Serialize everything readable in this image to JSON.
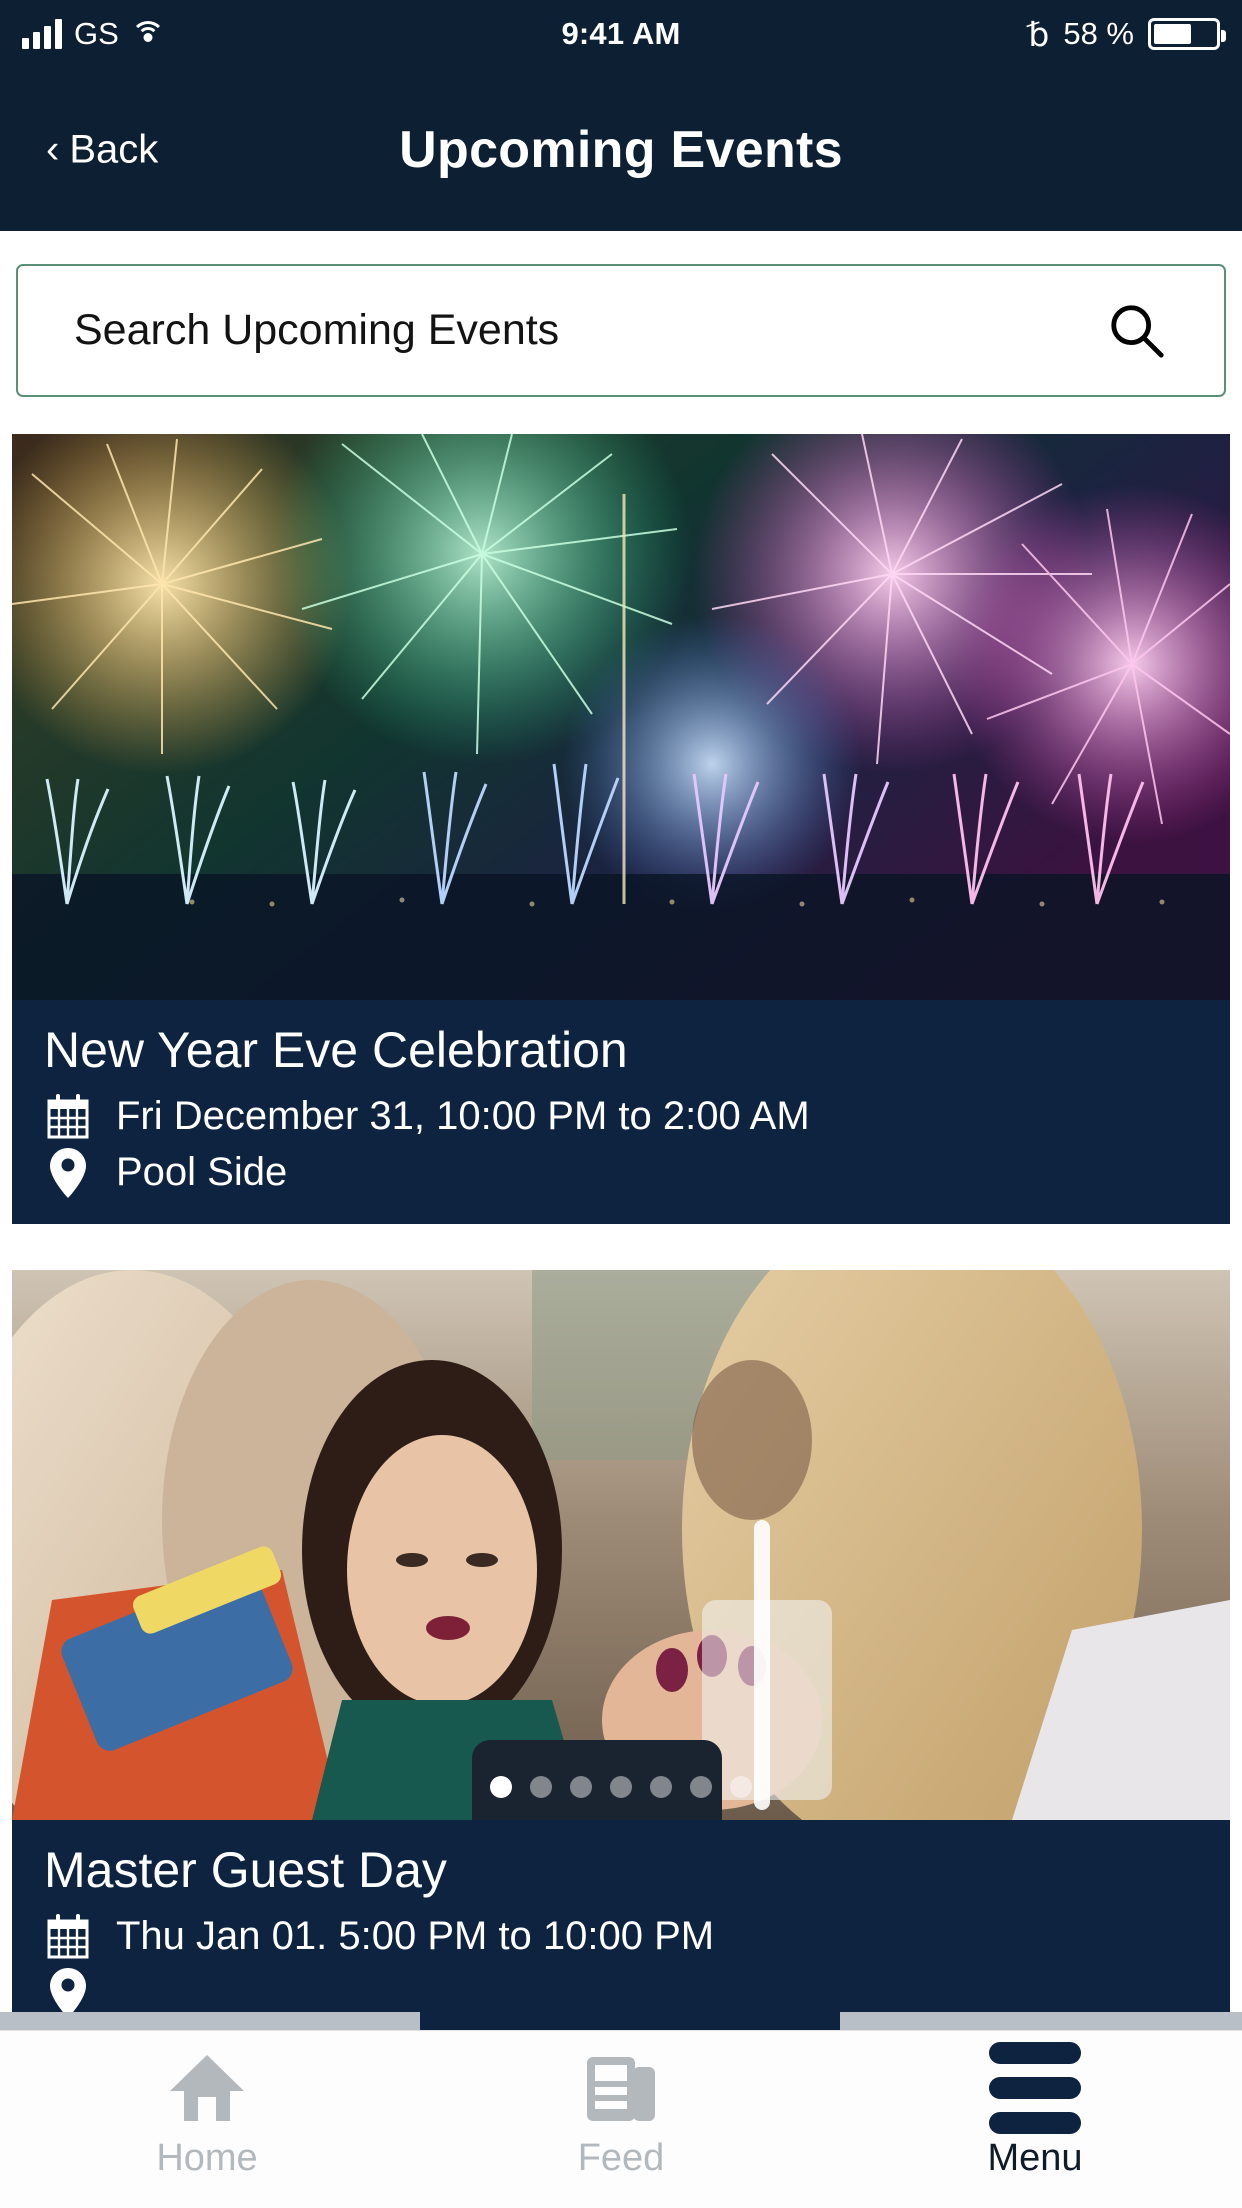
{
  "status_bar": {
    "carrier": "GS",
    "time": "9:41 AM",
    "battery_percent": "58 %",
    "signal_icon": "signal-bars-icon",
    "wifi_icon": "wifi-icon",
    "bluetooth_icon": "bluetooth-icon",
    "battery_icon": "battery-icon"
  },
  "nav": {
    "back_label": "Back",
    "back_chevron": "‹",
    "title": "Upcoming Events",
    "background_color": "#0d1f33"
  },
  "search": {
    "placeholder": "Search Upcoming Events",
    "icon": "search-icon",
    "border_color": "#589078"
  },
  "events": [
    {
      "title": "New Year Eve Celebration",
      "date_icon": "calendar-icon",
      "date": "Fri December 31, 10:00 PM to 2:00 AM",
      "location_icon": "map-pin-icon",
      "location": "Pool Side",
      "image": "fireworks-over-water",
      "info_background": "#0d2340"
    },
    {
      "title": "Master Guest Day",
      "date_icon": "calendar-icon",
      "date": "Thu Jan 01. 5:00 PM to 10:00 PM",
      "location_icon": "map-pin-icon",
      "location": "",
      "image": "women-at-outdoor-party",
      "info_background": "#0d2340",
      "carousel": {
        "total_dots": 7,
        "active_index": 0
      }
    }
  ],
  "tabbar": {
    "items": [
      {
        "label": "Home",
        "icon": "home-icon",
        "active": false
      },
      {
        "label": "Feed",
        "icon": "newspaper-icon",
        "active": false
      },
      {
        "label": "Menu",
        "icon": "hamburger-menu-icon",
        "active": true
      }
    ]
  }
}
